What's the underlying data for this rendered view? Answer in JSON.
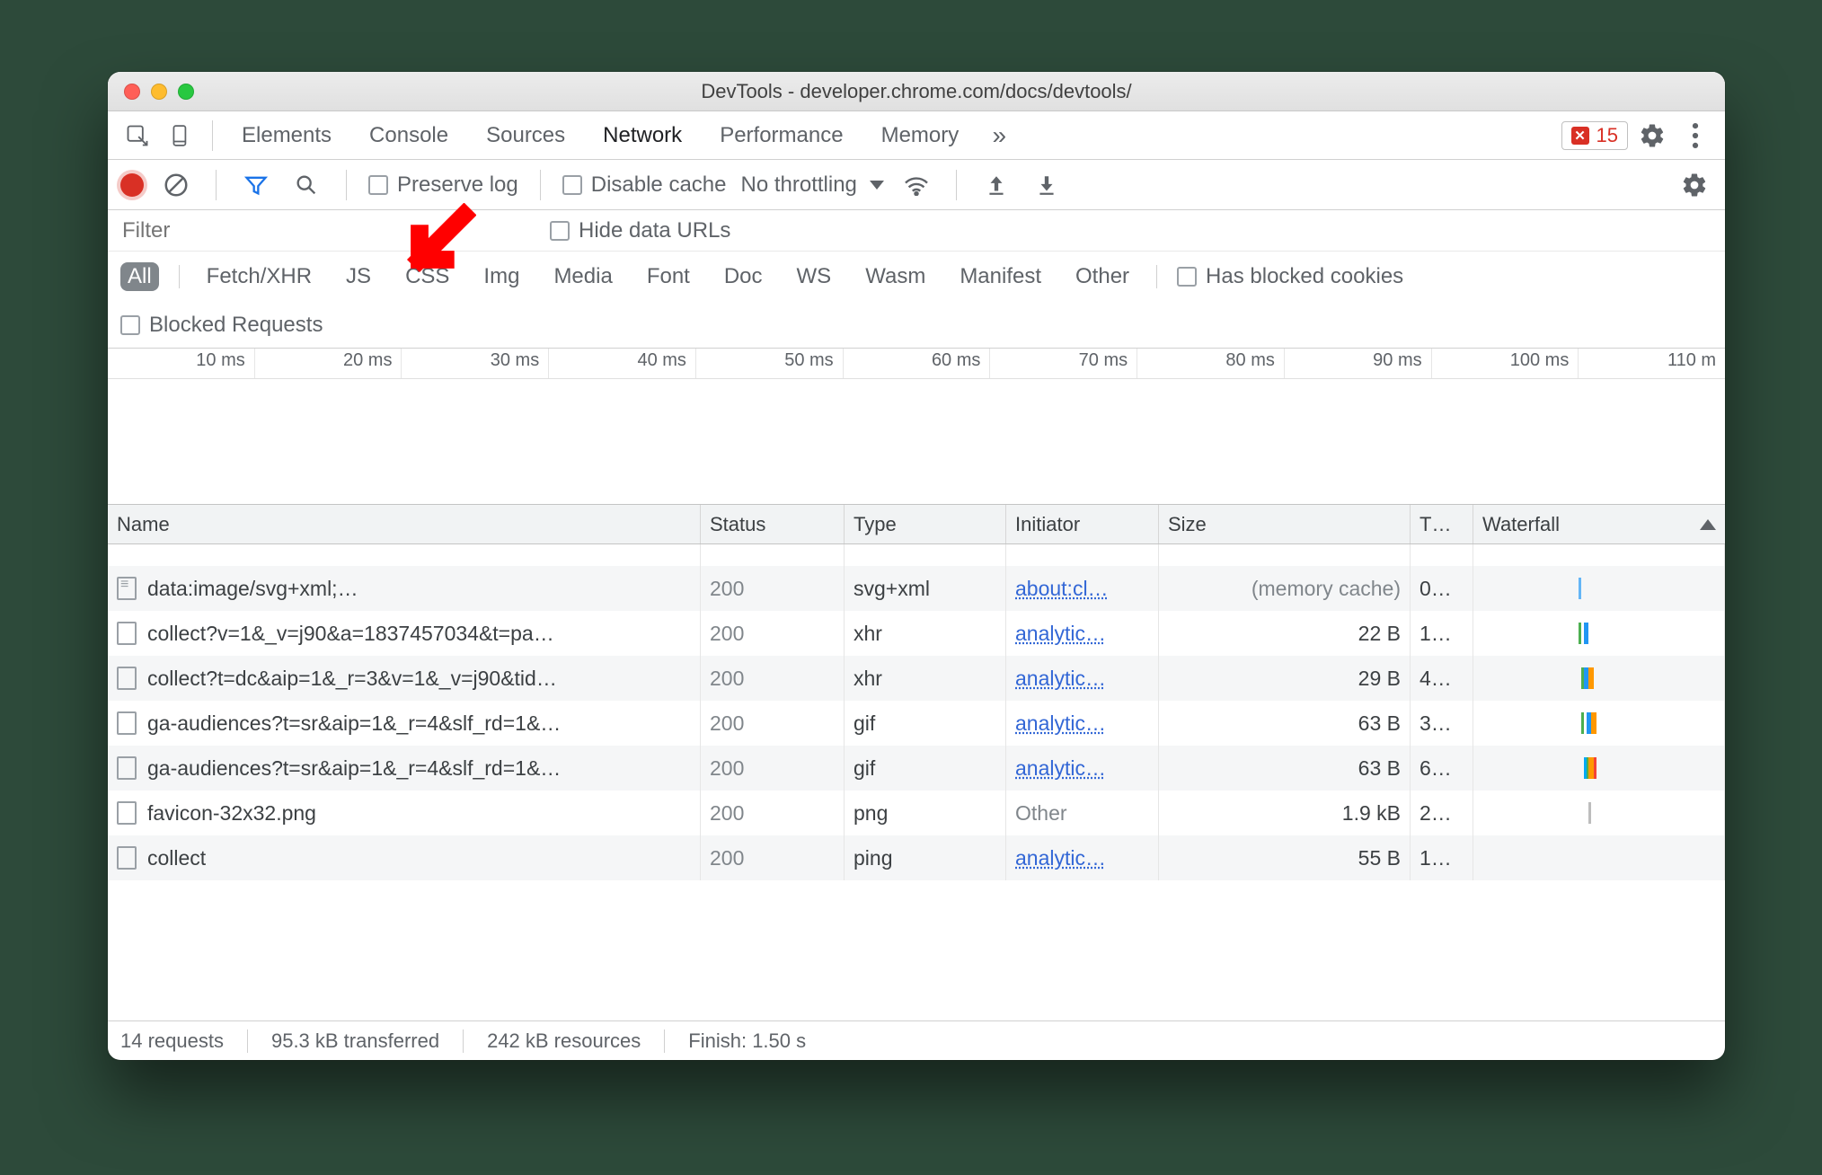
{
  "window": {
    "title": "DevTools - developer.chrome.com/docs/devtools/"
  },
  "tabs": {
    "items": [
      "Elements",
      "Console",
      "Sources",
      "Network",
      "Performance",
      "Memory"
    ],
    "active_index": 3,
    "error_count": "15"
  },
  "netbar": {
    "preserve_log": "Preserve log",
    "disable_cache": "Disable cache",
    "throttling": "No throttling"
  },
  "filter": {
    "placeholder": "Filter",
    "hide_data_urls": "Hide data URLs",
    "chips": [
      "All",
      "Fetch/XHR",
      "JS",
      "CSS",
      "Img",
      "Media",
      "Font",
      "Doc",
      "WS",
      "Wasm",
      "Manifest",
      "Other"
    ],
    "active_chip_index": 0,
    "has_blocked_cookies": "Has blocked cookies",
    "blocked_requests": "Blocked Requests"
  },
  "ruler_ticks": [
    "10 ms",
    "20 ms",
    "30 ms",
    "40 ms",
    "50 ms",
    "60 ms",
    "70 ms",
    "80 ms",
    "90 ms",
    "100 ms",
    "110 m"
  ],
  "headers": {
    "name": "Name",
    "status": "Status",
    "type": "Type",
    "initiator": "Initiator",
    "size": "Size",
    "time": "T…",
    "waterfall": "Waterfall"
  },
  "rows": [
    {
      "name": "data:image/svg+xml;…",
      "status": "200",
      "type": "svg+xml",
      "initiator": "about:cl…",
      "init_link": true,
      "size": "(memory cache)",
      "size_muted": true,
      "time": "0…",
      "icon": "doc",
      "wf": [
        {
          "l": 42,
          "w": 1,
          "c": "#64b5f6"
        }
      ]
    },
    {
      "name": "collect?v=1&_v=j90&a=1837457034&t=pa…",
      "status": "200",
      "type": "xhr",
      "initiator": "analytic…",
      "init_link": true,
      "size": "22 B",
      "time": "1…",
      "wf": [
        {
          "l": 42,
          "w": 1,
          "c": "#4caf50"
        },
        {
          "l": 44,
          "w": 2,
          "c": "#2196f3"
        }
      ]
    },
    {
      "name": "collect?t=dc&aip=1&_r=3&v=1&_v=j90&tid…",
      "status": "200",
      "type": "xhr",
      "initiator": "analytic…",
      "init_link": true,
      "size": "29 B",
      "time": "4…",
      "wf": [
        {
          "l": 43,
          "w": 1,
          "c": "#4caf50"
        },
        {
          "l": 44,
          "w": 2,
          "c": "#2196f3"
        },
        {
          "l": 46,
          "w": 2,
          "c": "#ff9800"
        }
      ]
    },
    {
      "name": "ga-audiences?t=sr&aip=1&_r=4&slf_rd=1&…",
      "status": "200",
      "type": "gif",
      "initiator": "analytic…",
      "init_link": true,
      "size": "63 B",
      "time": "3…",
      "wf": [
        {
          "l": 43,
          "w": 1,
          "c": "#4caf50"
        },
        {
          "l": 45,
          "w": 2,
          "c": "#2196f3"
        },
        {
          "l": 47,
          "w": 2,
          "c": "#ff9800"
        }
      ]
    },
    {
      "name": "ga-audiences?t=sr&aip=1&_r=4&slf_rd=1&…",
      "status": "200",
      "type": "gif",
      "initiator": "analytic…",
      "init_link": true,
      "size": "63 B",
      "time": "6…",
      "wf": [
        {
          "l": 44,
          "w": 1,
          "c": "#03a9f4"
        },
        {
          "l": 45,
          "w": 1,
          "c": "#4caf50"
        },
        {
          "l": 46,
          "w": 2,
          "c": "#ff9800"
        },
        {
          "l": 48,
          "w": 1,
          "c": "#f44336"
        }
      ]
    },
    {
      "name": "favicon-32x32.png",
      "status": "200",
      "type": "png",
      "initiator": "Other",
      "init_link": false,
      "size": "1.9 kB",
      "time": "2…",
      "wf": [
        {
          "l": 46,
          "w": 1,
          "c": "#bdbdbd"
        }
      ]
    },
    {
      "name": "collect",
      "status": "200",
      "type": "ping",
      "initiator": "analytic…",
      "init_link": true,
      "size": "55 B",
      "time": "1…",
      "wf": []
    }
  ],
  "status": {
    "requests": "14 requests",
    "transferred": "95.3 kB transferred",
    "resources": "242 kB resources",
    "finish": "Finish: 1.50 s"
  }
}
